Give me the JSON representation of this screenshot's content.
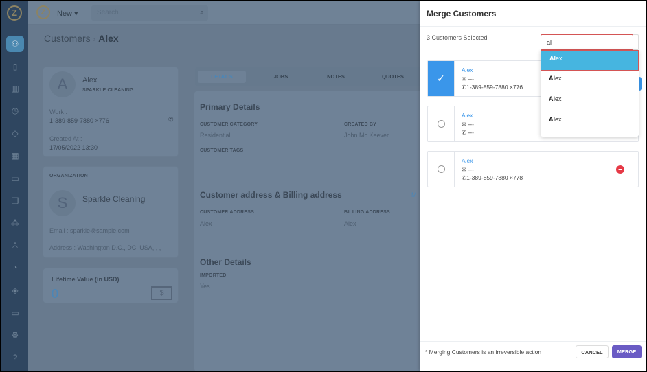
{
  "topbar": {
    "new_label": "New ▾",
    "search_placeholder": "Search.."
  },
  "sidebar": {
    "icons": [
      "customers-icon",
      "device-icon",
      "map-icon",
      "clock-icon",
      "tag-icon",
      "calculator-icon",
      "calendar-icon",
      "documents-icon",
      "cluster-icon",
      "user-icon",
      "pie-icon",
      "layers-icon",
      "monitor-icon",
      "gear-icon",
      "help-icon"
    ]
  },
  "breadcrumb": {
    "parent": "Customers",
    "separator": "›",
    "current": "Alex"
  },
  "profile": {
    "initial": "A",
    "name": "Alex",
    "company": "SPARKLE CLEANING",
    "work_label": "Work :",
    "work_phone": "1-389-859-7880 ×776",
    "created_label": "Created At :",
    "created_at": "17/05/2022 13:30"
  },
  "organization": {
    "heading": "ORGANIZATION",
    "initial": "S",
    "name": "Sparkle Cleaning",
    "email": "Email : sparkle@sample.com",
    "address": "Address : Washington D.C., DC, USA, , ,"
  },
  "lifetime": {
    "label": "Lifetime Value (in USD)",
    "value": "0"
  },
  "tabs": [
    "DETAILS",
    "JOBS",
    "NOTES",
    "QUOTES"
  ],
  "details": {
    "primary_title": "Primary Details",
    "category_label": "CUSTOMER CATEGORY",
    "category": "Residential",
    "created_by_label": "CREATED BY",
    "created_by": "John Mc Keever",
    "tags_label": "CUSTOMER TAGS",
    "tags": "—",
    "address_title": "Customer address & Billing address",
    "address_link": "M",
    "cust_addr_label": "CUSTOMER ADDRESS",
    "cust_addr": "Alex",
    "bill_addr_label": "BILLING ADDRESS",
    "bill_addr": "Alex",
    "other_title": "Other Details",
    "imported_label": "IMPORTED",
    "imported": "Yes"
  },
  "modal": {
    "title": "Merge Customers",
    "selected_count": "3 Customers Selected",
    "search_value": "al",
    "dropdown": [
      {
        "match": "Al",
        "rest": "ex"
      },
      {
        "match": "Al",
        "rest": "ex"
      },
      {
        "match": "Al",
        "rest": "ex"
      },
      {
        "match": "Al",
        "rest": "ex"
      }
    ],
    "customers": [
      {
        "name": "Alex",
        "email": "---",
        "phone": "1-389-859-7880 ×776",
        "selected": true
      },
      {
        "name": "Alex",
        "email": "---",
        "phone": "---",
        "selected": false
      },
      {
        "name": "Alex",
        "email": "---",
        "phone": "1-389-859-7880 ×778",
        "selected": false
      }
    ],
    "note": "* Merging Customers is an irreversible action",
    "cancel_label": "CANCEL",
    "merge_label": "MERGE"
  },
  "colors": {
    "accent": "#3a96ea",
    "merge": "#6a5bc4",
    "highlight": "#46b5e0",
    "remove": "#e63946"
  }
}
